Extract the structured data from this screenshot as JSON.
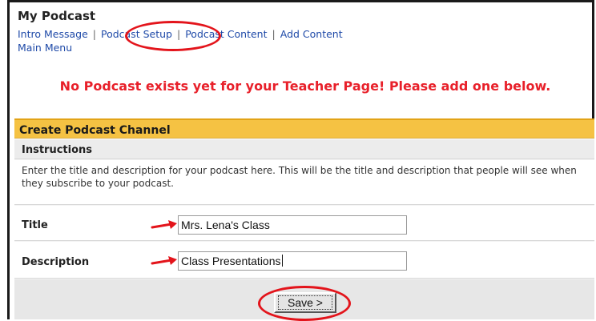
{
  "page": {
    "title": "My Podcast",
    "nav": {
      "intro_message": "Intro Message",
      "podcast_setup": "Podcast Setup",
      "podcast_content": "Podcast Content",
      "add_content": "Add Content",
      "main_menu": "Main Menu",
      "separator": "|"
    },
    "warning": "No Podcast exists yet for your Teacher Page! Please add one below."
  },
  "form": {
    "header": "Create Podcast Channel",
    "instructions_label": "Instructions",
    "instructions_text": "Enter the title and description for your podcast here. This will be the title and description that people will see when they subscribe to your podcast.",
    "title_label": "Title",
    "title_value": "Mrs. Lena's Class",
    "description_label": "Description",
    "description_value": "Class Presentations",
    "save_label": "Save >"
  },
  "colors": {
    "warning_red": "#e8202a",
    "header_yellow": "#f5c243",
    "link_blue": "#1f4aa8",
    "annotation_red": "#e3141b"
  },
  "icons": [
    "arrow-right-icon"
  ]
}
